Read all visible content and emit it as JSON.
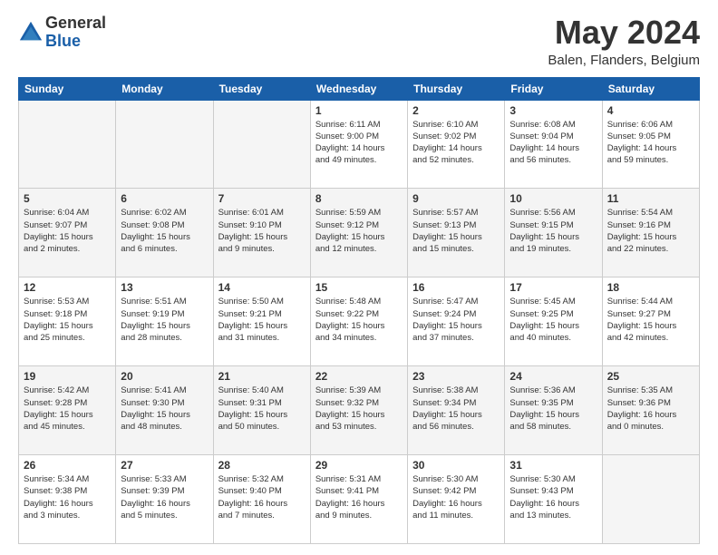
{
  "logo": {
    "general": "General",
    "blue": "Blue"
  },
  "header": {
    "month": "May 2024",
    "location": "Balen, Flanders, Belgium"
  },
  "weekdays": [
    "Sunday",
    "Monday",
    "Tuesday",
    "Wednesday",
    "Thursday",
    "Friday",
    "Saturday"
  ],
  "weeks": [
    [
      {
        "day": "",
        "info": ""
      },
      {
        "day": "",
        "info": ""
      },
      {
        "day": "",
        "info": ""
      },
      {
        "day": "1",
        "info": "Sunrise: 6:11 AM\nSunset: 9:00 PM\nDaylight: 14 hours\nand 49 minutes."
      },
      {
        "day": "2",
        "info": "Sunrise: 6:10 AM\nSunset: 9:02 PM\nDaylight: 14 hours\nand 52 minutes."
      },
      {
        "day": "3",
        "info": "Sunrise: 6:08 AM\nSunset: 9:04 PM\nDaylight: 14 hours\nand 56 minutes."
      },
      {
        "day": "4",
        "info": "Sunrise: 6:06 AM\nSunset: 9:05 PM\nDaylight: 14 hours\nand 59 minutes."
      }
    ],
    [
      {
        "day": "5",
        "info": "Sunrise: 6:04 AM\nSunset: 9:07 PM\nDaylight: 15 hours\nand 2 minutes."
      },
      {
        "day": "6",
        "info": "Sunrise: 6:02 AM\nSunset: 9:08 PM\nDaylight: 15 hours\nand 6 minutes."
      },
      {
        "day": "7",
        "info": "Sunrise: 6:01 AM\nSunset: 9:10 PM\nDaylight: 15 hours\nand 9 minutes."
      },
      {
        "day": "8",
        "info": "Sunrise: 5:59 AM\nSunset: 9:12 PM\nDaylight: 15 hours\nand 12 minutes."
      },
      {
        "day": "9",
        "info": "Sunrise: 5:57 AM\nSunset: 9:13 PM\nDaylight: 15 hours\nand 15 minutes."
      },
      {
        "day": "10",
        "info": "Sunrise: 5:56 AM\nSunset: 9:15 PM\nDaylight: 15 hours\nand 19 minutes."
      },
      {
        "day": "11",
        "info": "Sunrise: 5:54 AM\nSunset: 9:16 PM\nDaylight: 15 hours\nand 22 minutes."
      }
    ],
    [
      {
        "day": "12",
        "info": "Sunrise: 5:53 AM\nSunset: 9:18 PM\nDaylight: 15 hours\nand 25 minutes."
      },
      {
        "day": "13",
        "info": "Sunrise: 5:51 AM\nSunset: 9:19 PM\nDaylight: 15 hours\nand 28 minutes."
      },
      {
        "day": "14",
        "info": "Sunrise: 5:50 AM\nSunset: 9:21 PM\nDaylight: 15 hours\nand 31 minutes."
      },
      {
        "day": "15",
        "info": "Sunrise: 5:48 AM\nSunset: 9:22 PM\nDaylight: 15 hours\nand 34 minutes."
      },
      {
        "day": "16",
        "info": "Sunrise: 5:47 AM\nSunset: 9:24 PM\nDaylight: 15 hours\nand 37 minutes."
      },
      {
        "day": "17",
        "info": "Sunrise: 5:45 AM\nSunset: 9:25 PM\nDaylight: 15 hours\nand 40 minutes."
      },
      {
        "day": "18",
        "info": "Sunrise: 5:44 AM\nSunset: 9:27 PM\nDaylight: 15 hours\nand 42 minutes."
      }
    ],
    [
      {
        "day": "19",
        "info": "Sunrise: 5:42 AM\nSunset: 9:28 PM\nDaylight: 15 hours\nand 45 minutes."
      },
      {
        "day": "20",
        "info": "Sunrise: 5:41 AM\nSunset: 9:30 PM\nDaylight: 15 hours\nand 48 minutes."
      },
      {
        "day": "21",
        "info": "Sunrise: 5:40 AM\nSunset: 9:31 PM\nDaylight: 15 hours\nand 50 minutes."
      },
      {
        "day": "22",
        "info": "Sunrise: 5:39 AM\nSunset: 9:32 PM\nDaylight: 15 hours\nand 53 minutes."
      },
      {
        "day": "23",
        "info": "Sunrise: 5:38 AM\nSunset: 9:34 PM\nDaylight: 15 hours\nand 56 minutes."
      },
      {
        "day": "24",
        "info": "Sunrise: 5:36 AM\nSunset: 9:35 PM\nDaylight: 15 hours\nand 58 minutes."
      },
      {
        "day": "25",
        "info": "Sunrise: 5:35 AM\nSunset: 9:36 PM\nDaylight: 16 hours\nand 0 minutes."
      }
    ],
    [
      {
        "day": "26",
        "info": "Sunrise: 5:34 AM\nSunset: 9:38 PM\nDaylight: 16 hours\nand 3 minutes."
      },
      {
        "day": "27",
        "info": "Sunrise: 5:33 AM\nSunset: 9:39 PM\nDaylight: 16 hours\nand 5 minutes."
      },
      {
        "day": "28",
        "info": "Sunrise: 5:32 AM\nSunset: 9:40 PM\nDaylight: 16 hours\nand 7 minutes."
      },
      {
        "day": "29",
        "info": "Sunrise: 5:31 AM\nSunset: 9:41 PM\nDaylight: 16 hours\nand 9 minutes."
      },
      {
        "day": "30",
        "info": "Sunrise: 5:30 AM\nSunset: 9:42 PM\nDaylight: 16 hours\nand 11 minutes."
      },
      {
        "day": "31",
        "info": "Sunrise: 5:30 AM\nSunset: 9:43 PM\nDaylight: 16 hours\nand 13 minutes."
      },
      {
        "day": "",
        "info": ""
      }
    ]
  ]
}
